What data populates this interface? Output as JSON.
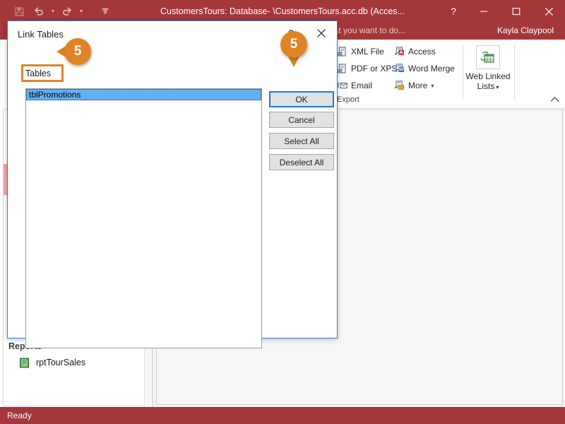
{
  "window": {
    "title": "CustomersTours: Database- \\CustomersTours.acc.db (Acces...",
    "user": "Kayla Claypool",
    "help_icon": "?",
    "minimize_icon": "minimize-icon",
    "maximize_icon": "maximize-icon",
    "close_icon": "close-icon"
  },
  "qat": {
    "save": "save-icon",
    "undo": "undo-icon",
    "redo": "redo-icon",
    "customize": "customize-qat-icon"
  },
  "tellme": {
    "text": "hat you want to do..."
  },
  "ribbon": {
    "export_group_label": "Export",
    "collapse_label": "^",
    "items": [
      {
        "label": "XML File",
        "icon": "xml-file-icon"
      },
      {
        "label": "PDF or XPS",
        "icon": "pdf-xps-icon"
      },
      {
        "label": "Email",
        "icon": "email-icon"
      },
      {
        "label": "Access",
        "icon": "access-export-icon"
      },
      {
        "label": "Word Merge",
        "icon": "word-merge-icon"
      },
      {
        "label": "More",
        "icon": "more-export-icon"
      }
    ],
    "web_linked_lists": {
      "line1": "Web Linked",
      "line2": "Lists",
      "icon": "web-linked-lists-icon"
    }
  },
  "navpane": {
    "group_title": "Reports",
    "collapse_icon": "chevron-up-icon",
    "items": [
      {
        "label": "rptTourSales",
        "icon": "report-icon"
      }
    ]
  },
  "statusbar": {
    "text": "Ready"
  },
  "dialog": {
    "title": "Link Tables",
    "help_icon": "?",
    "close_icon": "close-icon",
    "tables_label": "Tables",
    "list_items": [
      {
        "label": "tblPromotions",
        "selected": true
      }
    ],
    "buttons": [
      {
        "label": "OK",
        "default": true
      },
      {
        "label": "Cancel",
        "default": false
      },
      {
        "label": "Select All",
        "default": false
      },
      {
        "label": "Deselect All",
        "default": false
      }
    ]
  },
  "callouts": [
    {
      "number": "5",
      "target": "tables-label"
    },
    {
      "number": "5",
      "target": "ok-button"
    }
  ],
  "colors": {
    "titlebar": "#a4373a",
    "accent_orange": "#e08326",
    "selection_blue": "#62b1f6",
    "dialog_border_blue": "#2e7ccb",
    "default_button_blue": "#1a7fd4"
  }
}
